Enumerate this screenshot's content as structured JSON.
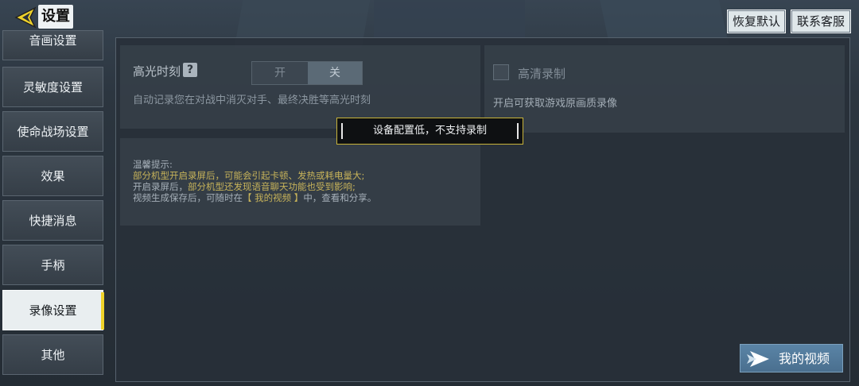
{
  "header": {
    "title": "设置",
    "restore_label": "恢复默认",
    "contact_label": "联系客服"
  },
  "sidebar": {
    "items": [
      {
        "label": "音画设置"
      },
      {
        "label": "灵敏度设置"
      },
      {
        "label": "使命战场设置"
      },
      {
        "label": "效果"
      },
      {
        "label": "快捷消息"
      },
      {
        "label": "手柄"
      },
      {
        "label": "录像设置",
        "active": true
      },
      {
        "label": "其他"
      }
    ]
  },
  "highlight": {
    "label": "高光时刻",
    "help_icon": "?",
    "toggle_on": "开",
    "toggle_off": "关",
    "selected": "关",
    "description": "自动记录您在对战中消灭对手、最终决胜等高光时刻"
  },
  "hd_record": {
    "label": "高清录制",
    "checked": false,
    "description": "开启可获取游戏原画质录像"
  },
  "tips": {
    "title": "温馨提示:",
    "line1": "部分机型开启录屏后，可能会引起卡顿、发热或耗电量大;",
    "line2_a": "开启录屏后，",
    "line2_b": "部分机型还发现语音聊天功能也受到影响;",
    "line3_a": "视频生成保存后，可随时在",
    "line3_b": "【 我的视频 】",
    "line3_c": "中，查看和分享。"
  },
  "toast": {
    "message": "设备配置低，不支持录制"
  },
  "my_videos": {
    "label": "我的视频"
  },
  "colors": {
    "accent_yellow": "#f0d32a",
    "tip_yellow": "#c7b35a",
    "button_blue": "#5a84a6"
  }
}
